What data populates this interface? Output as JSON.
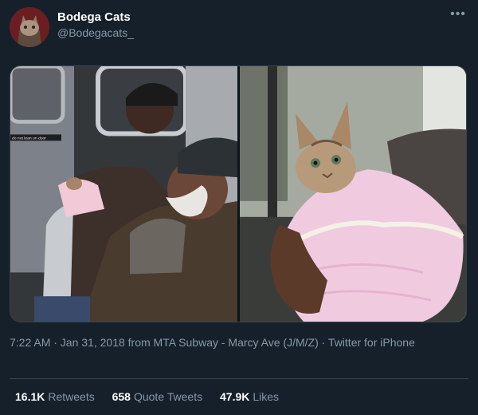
{
  "user": {
    "display_name": "Bodega Cats",
    "handle": "@Bodegacats_"
  },
  "tweet": {
    "timestamp": "7:22 AM · Jan 31, 2018 from MTA Subway - Marcy Ave (J/M/Z) · Twitter for iPhone",
    "media_sign_text": "do not lean on door"
  },
  "stats": {
    "retweets_count": "16.1K",
    "retweets_label": "Retweets",
    "quotes_count": "658",
    "quotes_label": "Quote Tweets",
    "likes_count": "47.9K",
    "likes_label": "Likes"
  },
  "icons": {
    "more": "more-options-icon"
  },
  "colors": {
    "background": "#15202b",
    "secondary_text": "#8899a6",
    "divider": "#38444d"
  }
}
